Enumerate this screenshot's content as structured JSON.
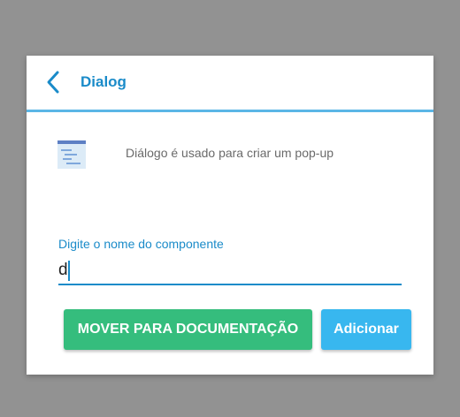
{
  "dialog": {
    "title": "Dialog",
    "back_icon": "chevron-left-icon",
    "component_icon": "dialog-component-icon",
    "description": "Diálogo é usado para criar um pop-up",
    "field": {
      "label": "Digite o nome do componente",
      "value": "d"
    },
    "buttons": {
      "move_label": "MOVER PARA DOCUMENTAÇÃO",
      "add_label": "Adicionar"
    }
  },
  "colors": {
    "overlay": "#929292",
    "accent": "#1a8bc9",
    "header_border": "#5bb6e6",
    "move_button": "#35bd7d",
    "add_button": "#38b7ef"
  }
}
